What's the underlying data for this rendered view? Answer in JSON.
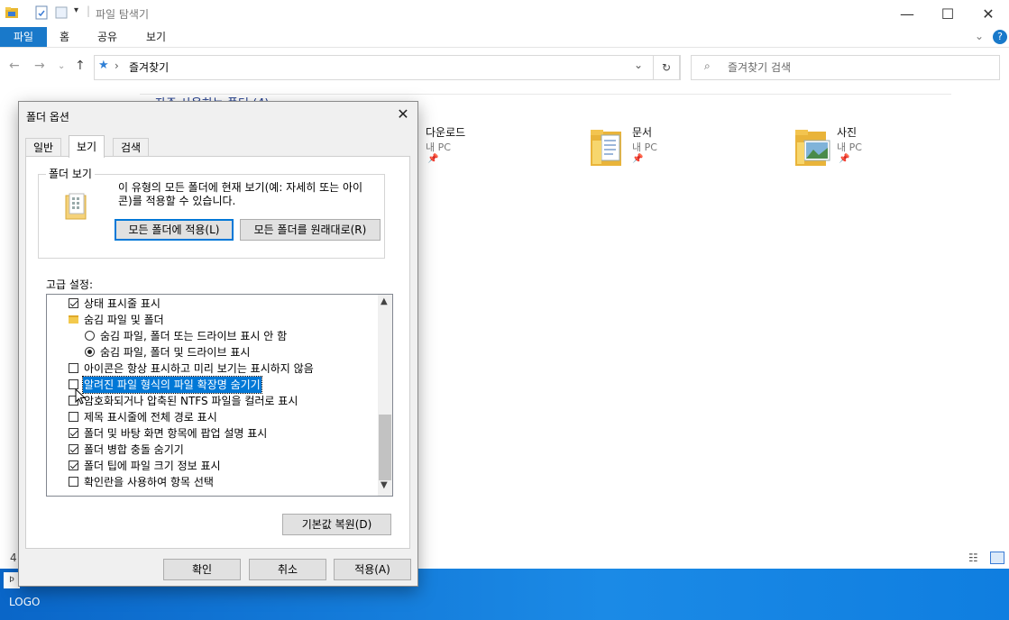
{
  "explorer": {
    "title": "파일 탐색기",
    "ribbon_tabs": [
      "파일",
      "홈",
      "공유",
      "보기"
    ],
    "address": "즐겨찾기",
    "search_placeholder": "즐겨찾기 검색",
    "section_header": "자주 사용하는 폴더 (4)",
    "folders": [
      {
        "name": "다운로드",
        "location": "내 PC"
      },
      {
        "name": "문서",
        "location": "내 PC"
      },
      {
        "name": "사진",
        "location": "내 PC"
      }
    ],
    "status_count": "4",
    "taskbar_logo": "LOGO"
  },
  "dialog": {
    "title": "폴더 옵션",
    "close": "✕",
    "tabs": [
      "일반",
      "보기",
      "검색"
    ],
    "active_tab": "보기",
    "folder_view": {
      "group_title": "폴더 보기",
      "description": "이 유형의 모든 폴더에 현재 보기(예: 자세히 또는 아이콘)를 적용할 수 있습니다.",
      "description_line1": "이 유형의 모든 폴더에 현재 보기(예: 자세히 또는 아이",
      "description_line2": "콘)를 적용할 수 있습니다.",
      "apply_button": "모든 폴더에 적용(L)",
      "reset_button": "모든 폴더를 원래대로(R)"
    },
    "advanced_label": "고급 설정:",
    "settings": [
      {
        "type": "checkbox",
        "checked": true,
        "label": "상태 표시줄 표시"
      },
      {
        "type": "folder",
        "label": "숨김 파일 및 폴더"
      },
      {
        "type": "radio",
        "selected": false,
        "label": "숨김 파일, 폴더 또는 드라이브 표시 안 함"
      },
      {
        "type": "radio",
        "selected": true,
        "label": "숨김 파일, 폴더 및 드라이브 표시"
      },
      {
        "type": "checkbox",
        "checked": false,
        "label": "아이콘은 항상 표시하고 미리 보기는 표시하지 않음"
      },
      {
        "type": "checkbox",
        "checked": false,
        "label": "알려진 파일 형식의 파일 확장명 숨기기",
        "highlighted": true
      },
      {
        "type": "checkbox",
        "checked": false,
        "label": "암호화되거나 압축된 NTFS 파일을 컬러로 표시"
      },
      {
        "type": "checkbox",
        "checked": false,
        "label": "제목 표시줄에 전체 경로 표시"
      },
      {
        "type": "checkbox",
        "checked": true,
        "label": "폴더 및 바탕 화면 항목에 팝업 설명 표시"
      },
      {
        "type": "checkbox",
        "checked": true,
        "label": "폴더 병합 충돌 숨기기"
      },
      {
        "type": "checkbox",
        "checked": true,
        "label": "폴더 팁에 파일 크기 정보 표시"
      },
      {
        "type": "checkbox",
        "checked": false,
        "label": "확인란을 사용하여 항목 선택"
      }
    ],
    "restore_defaults": "기본값 복원(D)",
    "ok": "확인",
    "cancel": "취소",
    "apply": "적용(A)"
  },
  "colors": {
    "accent": "#0078d7",
    "ribbon_file_tab": "#1979ca",
    "taskbar": "#0a66c8"
  }
}
